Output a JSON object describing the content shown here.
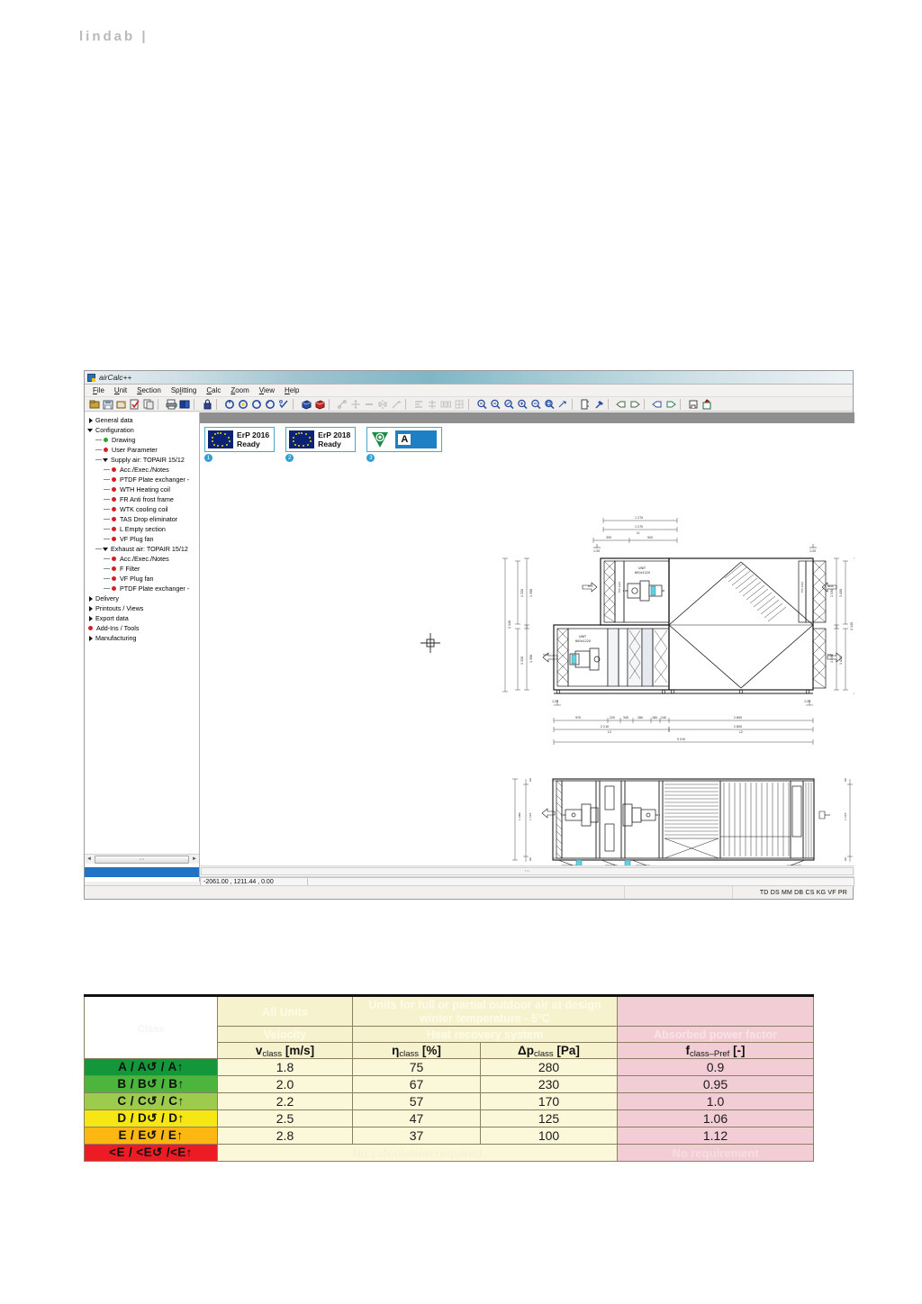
{
  "page": {
    "brand": "lindab",
    "brand_divider": "|"
  },
  "app": {
    "title": "airCalc++",
    "menu": [
      "File",
      "Unit",
      "Section",
      "Splitting",
      "Calc",
      "Zoom",
      "View",
      "Help"
    ],
    "toolbar_icons": [
      "open-folder-icon",
      "save-icon",
      "save-as-icon",
      "check-document-icon",
      "copy-document-icon",
      "print-icon",
      "book-icon",
      "lock-icon",
      "refresh-ccw-icon",
      "refresh-cw-icon",
      "reload-blue-icon",
      "reload-cyan-icon",
      "calc-check-icon",
      "cube-blue-icon",
      "cube-red-icon",
      "scale-icon",
      "move-icon",
      "line-icon",
      "mirror-icon",
      "measure-icon",
      "align-icon",
      "center-icon",
      "distribute-icon",
      "grid-icon",
      "zoom-window-icon",
      "zoom-out-icon",
      "zoom-dynamic-icon",
      "zoom-in-icon",
      "zoom-minus-icon",
      "zoom-extents-icon",
      "pan-icon",
      "section-icon",
      "hammer-icon",
      "view-left-icon",
      "view-right-icon",
      "view-front-icon",
      "view-back-icon",
      "print-preview-icon",
      "export-icon"
    ],
    "tree": [
      {
        "label": "General data",
        "depth": 0,
        "marker": "triangle-right"
      },
      {
        "label": "Configuration",
        "depth": 0,
        "marker": "triangle-down"
      },
      {
        "label": "Drawing",
        "depth": 1,
        "marker": "dot-green"
      },
      {
        "label": "User Parameter",
        "depth": 1,
        "marker": "dot-red"
      },
      {
        "label": "Supply air: TOPAIR 15/12",
        "depth": 1,
        "marker": "triangle-down"
      },
      {
        "label": "Acc./Exec./Notes",
        "depth": 2,
        "marker": "dot-red"
      },
      {
        "label": "PTDF Plate exchanger -",
        "depth": 2,
        "marker": "dot-red"
      },
      {
        "label": "WTH Heating coil",
        "depth": 2,
        "marker": "dot-red"
      },
      {
        "label": "FR Anti frost frame",
        "depth": 2,
        "marker": "dot-red"
      },
      {
        "label": "WTK cooling coil",
        "depth": 2,
        "marker": "dot-red"
      },
      {
        "label": "TAS Drop eliminator",
        "depth": 2,
        "marker": "dot-red"
      },
      {
        "label": "L Empty section",
        "depth": 2,
        "marker": "dot-red"
      },
      {
        "label": "VF Plug fan",
        "depth": 2,
        "marker": "dot-red"
      },
      {
        "label": "Exhaust air: TOPAIR 15/12",
        "depth": 1,
        "marker": "triangle-down"
      },
      {
        "label": "Acc./Exec./Notes",
        "depth": 2,
        "marker": "dot-red"
      },
      {
        "label": "F Filter",
        "depth": 2,
        "marker": "dot-red"
      },
      {
        "label": "VF Plug fan",
        "depth": 2,
        "marker": "dot-red"
      },
      {
        "label": "PTDF Plate exchanger -",
        "depth": 2,
        "marker": "dot-red"
      },
      {
        "label": "Delivery",
        "depth": 0,
        "marker": "triangle-right"
      },
      {
        "label": "Printouts / Views",
        "depth": 0,
        "marker": "triangle-right"
      },
      {
        "label": "Export data",
        "depth": 0,
        "marker": "triangle-right"
      },
      {
        "label": "Add-Ins / Tools",
        "depth": 0,
        "marker": "dot-red"
      },
      {
        "label": "Manufacturing",
        "depth": 0,
        "marker": "triangle-right"
      }
    ],
    "badges": [
      {
        "id": "1",
        "line1": "ErP 2016",
        "line2": "Ready",
        "icon": "eu-flag-icon"
      },
      {
        "id": "2",
        "line1": "ErP 2018",
        "line2": "Ready",
        "icon": "eu-flag-icon"
      },
      {
        "id": "3",
        "class_letter": "A",
        "icon": "eurovent-eco-icon"
      }
    ],
    "status": {
      "coordinates": "-2061.00 , 1211.44 , 0.00",
      "flags": "TD DS MM DB CS KG VF PR"
    },
    "drawing": {
      "label_unit_1": "UNIT",
      "label_size_1": "600x1220",
      "label_unit_2": "UNIT",
      "label_size_2": "600x1220"
    }
  },
  "erp_table": {
    "header": {
      "class_col": "Class",
      "all_units": "All Units",
      "outdoor_units": "Units for full or partial outdoor air at design winter temperature - 5°C",
      "velocity": "Velocity",
      "heat_recovery": "Heat recovery system",
      "absorbed_power": "Absorbed power factor"
    },
    "units_row": [
      {
        "symbol": "v",
        "sub": "class",
        "unit": "[m/s]"
      },
      {
        "symbol": "η",
        "sub": "class",
        "unit": "[%]"
      },
      {
        "symbol": "Δp",
        "sub": "class",
        "unit": "[Pa]"
      },
      {
        "symbol": "f",
        "sub": "class–Pref",
        "unit": "[-]"
      }
    ],
    "rows": [
      {
        "class": "A / A↺ / A↑",
        "color": "#14973b",
        "v": "1.8",
        "eta": "75",
        "dp": "280",
        "f": "0.9"
      },
      {
        "class": "B / B↺ / B↑",
        "color": "#4cb53b",
        "v": "2.0",
        "eta": "67",
        "dp": "230",
        "f": "0.95"
      },
      {
        "class": "C / C↺ / C↑",
        "color": "#9ccb4e",
        "v": "2.2",
        "eta": "57",
        "dp": "170",
        "f": "1.0"
      },
      {
        "class": "D / D↺ / D↑",
        "color": "#f5e614",
        "v": "2.5",
        "eta": "47",
        "dp": "125",
        "f": "1.06"
      },
      {
        "class": "E / E↺ / E↑",
        "color": "#fcb713",
        "v": "2.8",
        "eta": "37",
        "dp": "100",
        "f": "1.12"
      },
      {
        "class": "<E / <E↺ /<E↑",
        "color": "#ed1c24",
        "v": null,
        "eta": null,
        "dp": null,
        "f": null
      }
    ],
    "last_row_notes": {
      "calc": "No calculation required",
      "req": "No requirement"
    }
  }
}
